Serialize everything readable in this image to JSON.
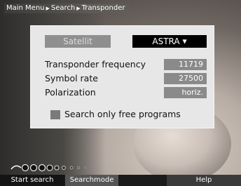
{
  "breadcrumb": {
    "items": [
      "Main Menu",
      "Search",
      "Transponder"
    ],
    "separator": "▶"
  },
  "satellite": {
    "label": "Satellit",
    "value": "ASTRA",
    "dropdown_icon": "caret-down-icon"
  },
  "fields": [
    {
      "label": "Transponder frequency",
      "value": "11719"
    },
    {
      "label": "Symbol rate",
      "value": "27500"
    },
    {
      "label": "Polarization",
      "value": "horiz."
    }
  ],
  "option": {
    "label": "Search only free programs"
  },
  "buttons": {
    "start_search": "Start search",
    "searchmode": "Searchmode",
    "help": "Help"
  },
  "colors": {
    "panel": "#e7e7e7",
    "value_box": "#8a8a8a",
    "select_box": "#000000",
    "bottom_bar": "#1b1b1b"
  }
}
